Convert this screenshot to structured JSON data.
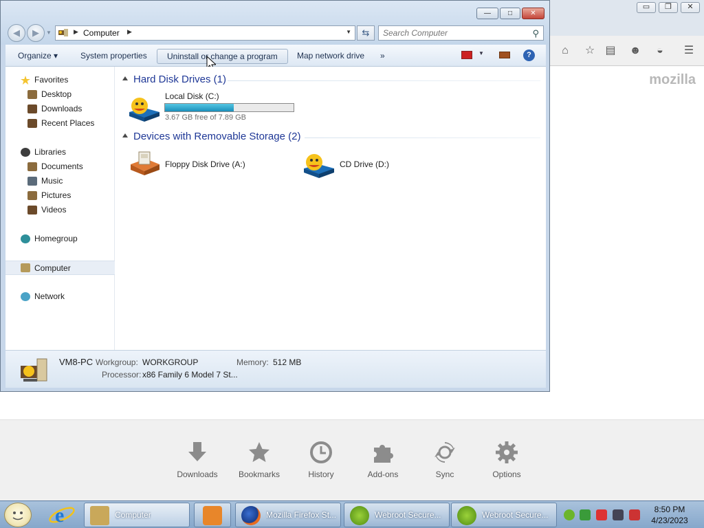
{
  "firefox": {
    "brand": "mozilla",
    "caption": {
      "minimize": "▭",
      "restore": "❐",
      "close": "✕"
    },
    "launcher": [
      {
        "label": "Downloads",
        "icon": "download-icon"
      },
      {
        "label": "Bookmarks",
        "icon": "star-icon"
      },
      {
        "label": "History",
        "icon": "clock-icon"
      },
      {
        "label": "Add-ons",
        "icon": "puzzle-icon"
      },
      {
        "label": "Sync",
        "icon": "sync-icon"
      },
      {
        "label": "Options",
        "icon": "gear-icon"
      }
    ],
    "toolbar_icons": [
      "home-icon",
      "bookmark-star-icon",
      "clipboard-icon",
      "chat-icon",
      "pocket-icon",
      "menu-icon"
    ]
  },
  "explorer": {
    "address": {
      "path": "Computer"
    },
    "search": {
      "placeholder": "Search Computer"
    },
    "caption": {
      "minimize": "—",
      "maximize": "□",
      "close": "✕"
    },
    "toolbar": {
      "organize": "Organize ▾",
      "system_properties": "System properties",
      "uninstall": "Uninstall or change a program",
      "map_drive": "Map network drive",
      "more": "»"
    },
    "nav": {
      "favorites": "Favorites",
      "desktop": "Desktop",
      "downloads": "Downloads",
      "recent": "Recent Places",
      "libraries": "Libraries",
      "documents": "Documents",
      "music": "Music",
      "pictures": "Pictures",
      "videos": "Videos",
      "homegroup": "Homegroup",
      "computer": "Computer",
      "network": "Network"
    },
    "groups": {
      "hdd": "Hard Disk Drives (1)",
      "removable": "Devices with Removable Storage (2)"
    },
    "drives": {
      "c_label": "Local Disk (C:)",
      "c_free": "3.67 GB free of 7.89 GB",
      "c_used_fraction": 0.535,
      "floppy": "Floppy Disk Drive (A:)",
      "cd": "CD Drive (D:)"
    },
    "details": {
      "pc_name": "VM8-PC",
      "workgroup_key": "Workgroup:",
      "workgroup": "WORKGROUP",
      "memory_key": "Memory:",
      "memory": "512 MB",
      "processor_key": "Processor:",
      "processor": "x86 Family 6 Model 7 St..."
    }
  },
  "taskbar": {
    "tasks": {
      "computer": "Computer",
      "firefox": "Mozilla Firefox St...",
      "webroot1": "Webroot Secure...",
      "webroot2": "Webroot Secure..."
    },
    "clock": {
      "time": "8:50 PM",
      "date": "4/23/2023"
    }
  }
}
